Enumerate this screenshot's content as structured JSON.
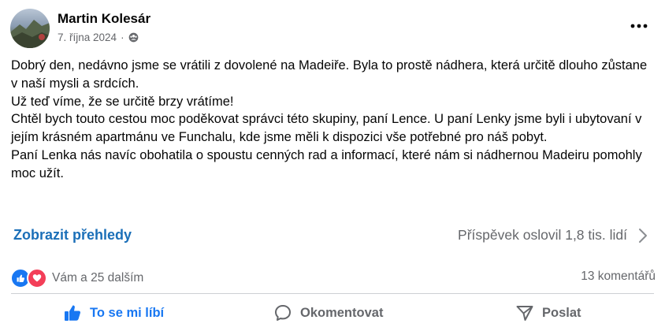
{
  "post": {
    "author": "Martin Kolesár",
    "date": "7. října 2024",
    "separator": "·",
    "privacy_icon": "group-icon",
    "more_icon": "more-options-icon",
    "text": "Dobrý den, nedávno jsme se vrátili z dovolené na Madeiře. Byla to prostě nádhera, která určitě dlouho zůstane v naší mysli a srdcích.\nUž teď víme, že se určitě brzy vrátíme!\nChtěl bych touto cestou moc poděkovat správci této skupiny, paní Lence. U paní Lenky jsme byli i ubytovaní v jejím krásném apartmánu ve Funchalu, kde jsme měli k dispozici vše potřebné pro náš pobyt.\nPaní Lenka nás navíc obohatila o spoustu cenných rad a informací, které nám si nádhernou Madeiru pomohly moc užít."
  },
  "insights": {
    "link": "Zobrazit přehledy",
    "reach": "Příspěvek oslovil 1,8 tis. lidí"
  },
  "engagement": {
    "reactions_text": "Vám a 25 dalším",
    "comments": "13 komentářů"
  },
  "actions": {
    "like": "To se mi líbí",
    "comment": "Okomentovat",
    "share": "Poslat"
  },
  "colors": {
    "link_blue": "#1b6fb8",
    "like_blue": "#1877f2",
    "love_red": "#f33e58",
    "secondary_text": "#65676b"
  }
}
